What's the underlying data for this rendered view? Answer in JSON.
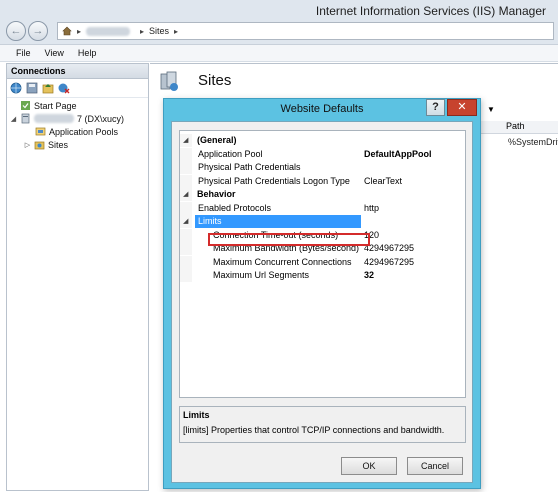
{
  "window": {
    "title": "Internet Information Services (IIS) Manager",
    "nav_back": "←",
    "nav_forward": "→"
  },
  "address_bar": {
    "server_crumb_tail": "7",
    "separator": "▸",
    "crumb_sites": "Sites"
  },
  "menu": {
    "items": [
      "File",
      "View",
      "Help"
    ]
  },
  "connections": {
    "header": "Connections",
    "tree": {
      "start_page": "Start Page",
      "server_suffix": "7 (DX\\xucy)",
      "app_pools": "Application Pools",
      "sites": "Sites"
    }
  },
  "main": {
    "title": "Sites",
    "column_path": "Path",
    "path_value": "%SystemDriv"
  },
  "dialog": {
    "title": "Website Defaults",
    "help": "?",
    "close": "✕",
    "rows": [
      {
        "kind": "category",
        "name": "(General)"
      },
      {
        "kind": "prop",
        "name": "Application Pool",
        "value": "DefaultAppPool",
        "bold": true
      },
      {
        "kind": "prop",
        "name": "Physical Path Credentials",
        "value": ""
      },
      {
        "kind": "prop",
        "name": "Physical Path Credentials Logon Type",
        "value": "ClearText"
      },
      {
        "kind": "category",
        "name": "Behavior"
      },
      {
        "kind": "prop",
        "name": "Enabled Protocols",
        "value": "http"
      },
      {
        "kind": "sub-category",
        "name": "Limits"
      },
      {
        "kind": "subprop",
        "name": "Connection Time-out (seconds)",
        "value": "120"
      },
      {
        "kind": "subprop",
        "name": "Maximum Bandwidth (Bytes/second)",
        "value": "4294967295"
      },
      {
        "kind": "subprop",
        "name": "Maximum Concurrent Connections",
        "value": "4294967295"
      },
      {
        "kind": "subprop",
        "name": "Maximum Url Segments",
        "value": "32",
        "bold": true
      }
    ],
    "description": {
      "title": "Limits",
      "text": "[limits] Properties that control TCP/IP connections and bandwidth."
    },
    "ok": "OK",
    "cancel": "Cancel"
  }
}
